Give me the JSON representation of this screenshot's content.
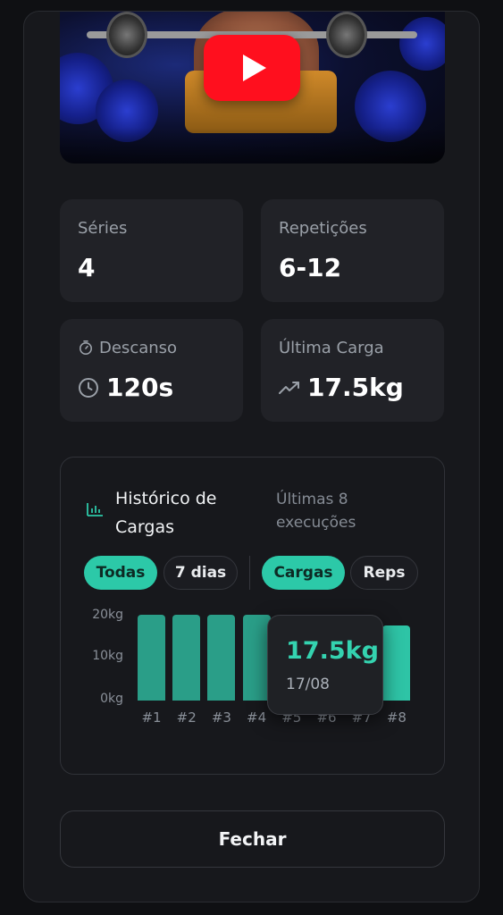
{
  "video": {
    "icon": "youtube-play-icon"
  },
  "stats": {
    "series": {
      "label": "Séries",
      "value": "4"
    },
    "reps": {
      "label": "Repetições",
      "value": "6-12"
    },
    "rest": {
      "label": "Descanso",
      "value": "120s",
      "label_icon": "stopwatch-icon",
      "value_icon": "clock-icon"
    },
    "last_load": {
      "label": "Última Carga",
      "value": "17.5kg",
      "value_icon": "trending-up-icon"
    }
  },
  "history": {
    "title": "Histórico de Cargas",
    "subtitle": "Últimas 8 execuções",
    "filters": [
      {
        "label": "Todas",
        "active": true
      },
      {
        "label": "7 dias",
        "active": false
      }
    ],
    "metrics": [
      {
        "label": "Cargas",
        "active": true
      },
      {
        "label": "Reps",
        "active": false
      }
    ],
    "tooltip": {
      "value": "17.5kg",
      "date": "17/08"
    }
  },
  "chart_data": {
    "type": "bar",
    "categories": [
      "#1",
      "#2",
      "#3",
      "#4",
      "#5",
      "#6",
      "#7",
      "#8"
    ],
    "values": [
      20,
      20,
      20,
      20,
      17.5,
      17.5,
      17.5,
      17.5
    ],
    "highlighted_index": 7,
    "yticks": [
      "20kg",
      "10kg",
      "0kg"
    ],
    "ylim": [
      0,
      20
    ],
    "grid": false,
    "colors": {
      "bar": "#2a9e88",
      "highlight": "#2ec4a6"
    }
  },
  "footer": {
    "close_label": "Fechar"
  }
}
